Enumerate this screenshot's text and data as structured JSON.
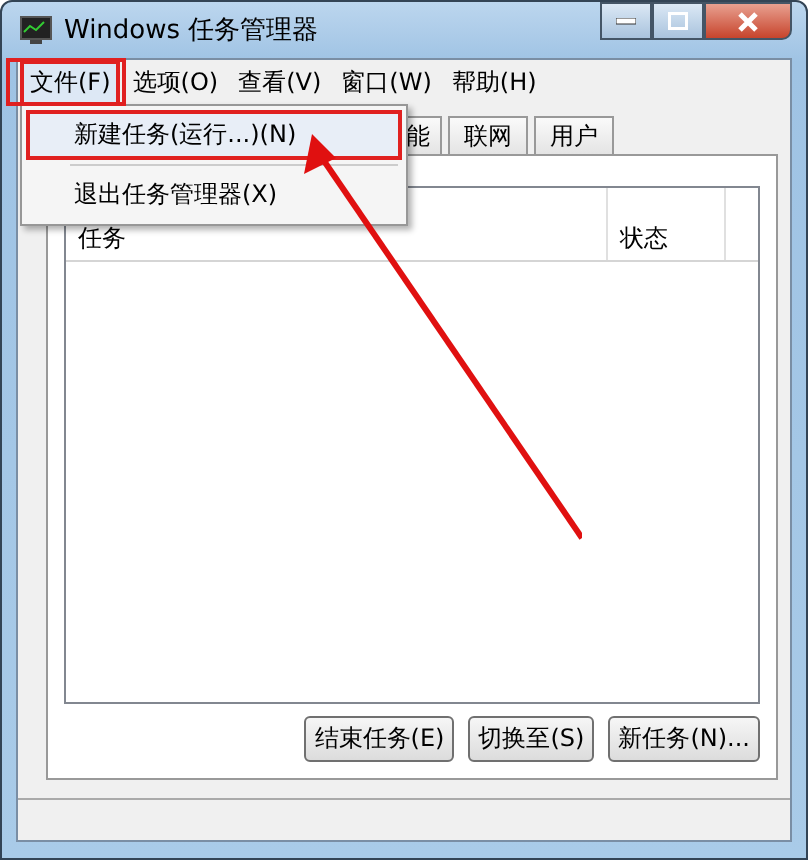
{
  "window": {
    "title": "Windows 任务管理器"
  },
  "menu_bar": [
    {
      "label": "文件(F)",
      "selected": true
    },
    {
      "label": "选项(O)",
      "selected": false
    },
    {
      "label": "查看(V)",
      "selected": false
    },
    {
      "label": "窗口(W)",
      "selected": false
    },
    {
      "label": "帮助(H)",
      "selected": false
    }
  ],
  "file_menu": [
    {
      "label": "新建任务(运行...)(N)",
      "highlighted": true
    },
    {
      "label": "退出任务管理器(X)",
      "highlighted": false
    }
  ],
  "tabs": [
    "能",
    "联网",
    "用户"
  ],
  "table": {
    "columns": [
      "任务",
      "状态"
    ]
  },
  "buttons": [
    "结束任务(E)",
    "切换至(S)",
    "新任务(N)..."
  ]
}
